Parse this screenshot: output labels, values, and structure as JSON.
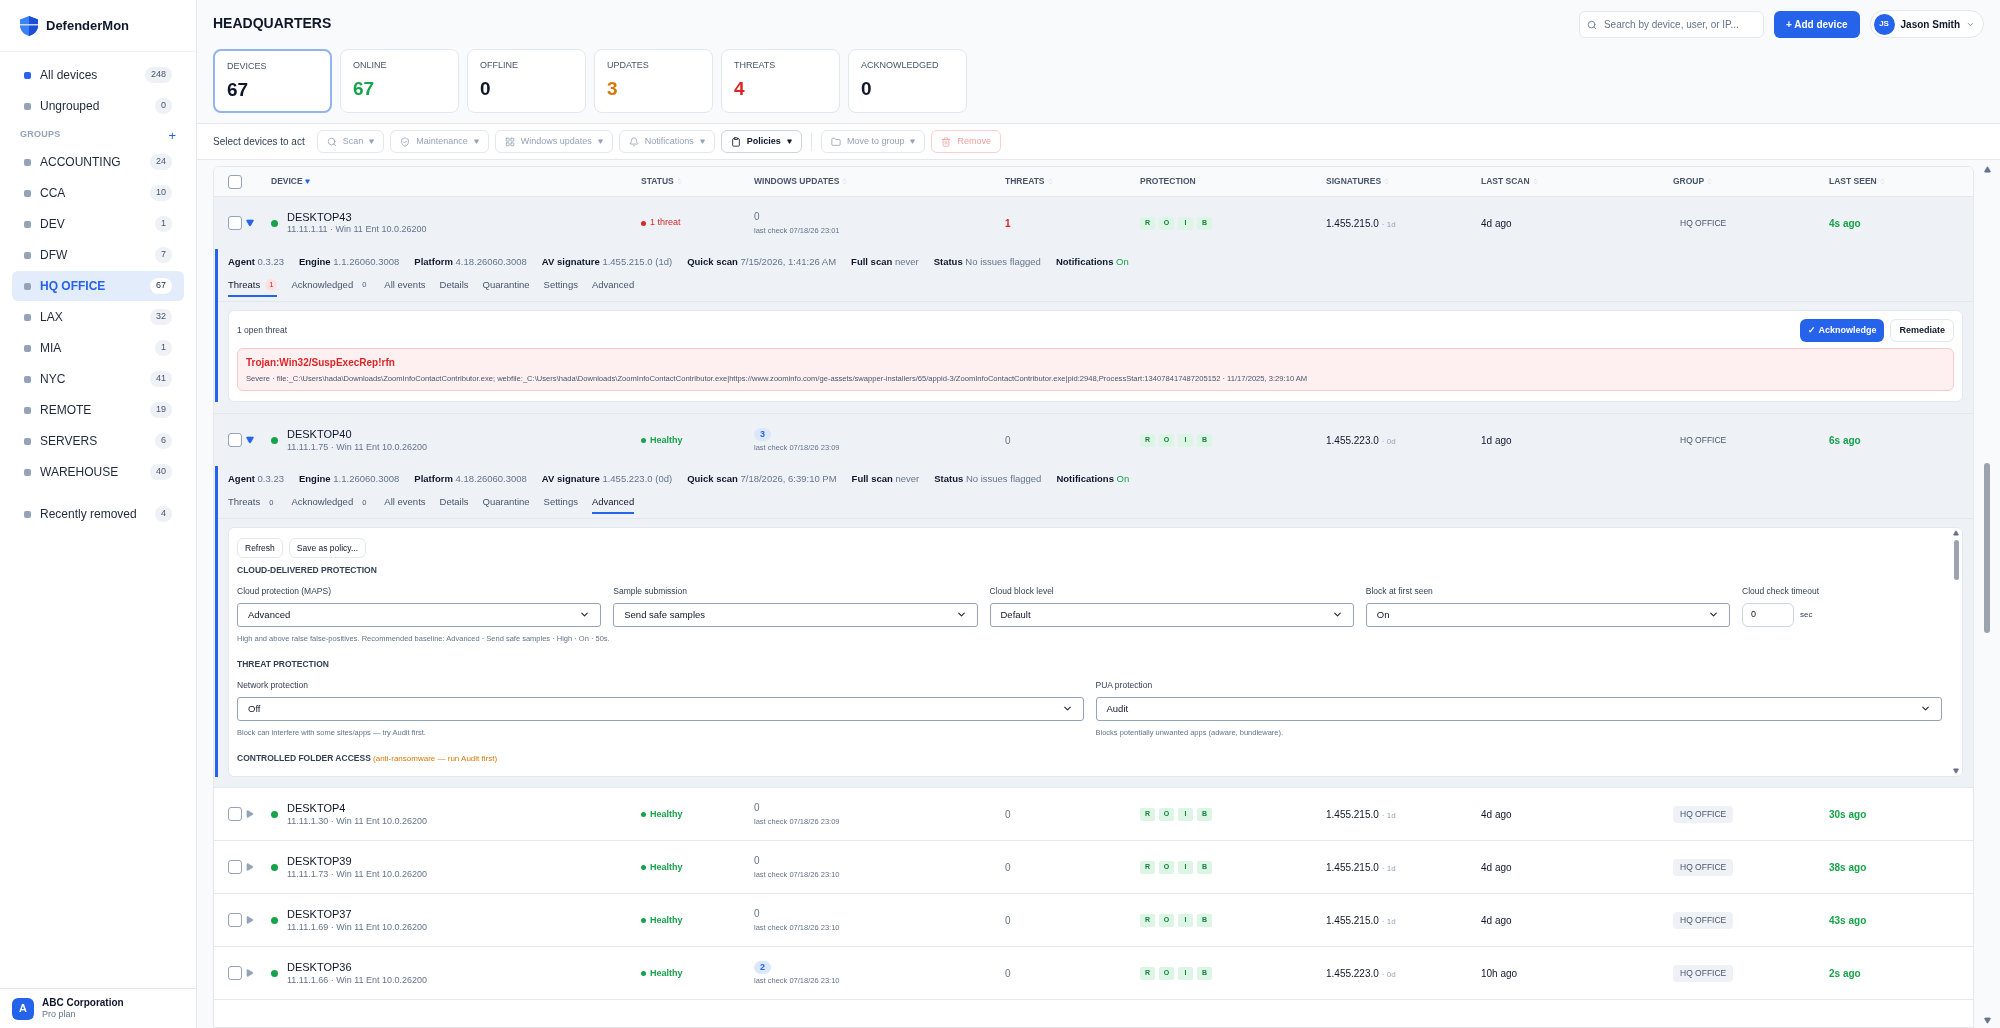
{
  "brand": {
    "name": "DefenderMon"
  },
  "sidebar": {
    "items": [
      {
        "label": "All devices",
        "count": "248",
        "selected": false,
        "color": "#2563eb"
      },
      {
        "label": "Ungrouped",
        "count": "0",
        "selected": false,
        "color": "#94a3b8"
      }
    ],
    "groups_heading": "GROUPS",
    "add_label": "+",
    "groups": [
      {
        "label": "ACCOUNTING",
        "count": "24",
        "selected": false
      },
      {
        "label": "CCA",
        "count": "10",
        "selected": false
      },
      {
        "label": "DEV",
        "count": "1",
        "selected": false
      },
      {
        "label": "DFW",
        "count": "7",
        "selected": false
      },
      {
        "label": "HQ OFFICE",
        "count": "67",
        "selected": true
      },
      {
        "label": "LAX",
        "count": "32",
        "selected": false
      },
      {
        "label": "MIA",
        "count": "1",
        "selected": false
      },
      {
        "label": "NYC",
        "count": "41",
        "selected": false
      },
      {
        "label": "REMOTE",
        "count": "19",
        "selected": false
      },
      {
        "label": "SERVERS",
        "count": "6",
        "selected": false
      },
      {
        "label": "WAREHOUSE",
        "count": "40",
        "selected": false
      }
    ],
    "removed": {
      "label": "Recently removed",
      "count": "4"
    },
    "org": {
      "initial": "A",
      "name": "ABC Corporation",
      "plan": "Pro plan"
    }
  },
  "header": {
    "title": "HEADQUARTERS",
    "search": {
      "placeholder": "Search by device, user, or IP..."
    },
    "add_button": "+ Add device",
    "user": {
      "initials": "JS",
      "name": "Jason Smith"
    }
  },
  "stats": [
    {
      "label": "DEVICES",
      "value": "67",
      "selected": true,
      "color": "#0f172a"
    },
    {
      "label": "ONLINE",
      "value": "67",
      "selected": false,
      "color": "#16a34a"
    },
    {
      "label": "OFFLINE",
      "value": "0",
      "selected": false,
      "color": "#0f172a"
    },
    {
      "label": "UPDATES",
      "value": "3",
      "selected": false,
      "color": "#d97706"
    },
    {
      "label": "THREATS",
      "value": "4",
      "selected": false,
      "color": "#dc2626"
    },
    {
      "label": "ACKNOWLEDGED",
      "value": "0",
      "selected": false,
      "color": "#0f172a"
    }
  ],
  "toolbar": {
    "hint": "Select devices to act",
    "actions": [
      {
        "label": "Scan",
        "disabled": true,
        "danger": false,
        "menu": true
      },
      {
        "label": "Maintenance",
        "disabled": true,
        "danger": false,
        "menu": true
      },
      {
        "label": "Windows updates",
        "disabled": true,
        "danger": false,
        "menu": true
      },
      {
        "label": "Notifications",
        "disabled": true,
        "danger": false,
        "menu": true
      },
      {
        "label": "Policies",
        "disabled": false,
        "danger": false,
        "menu": true
      },
      {
        "label": "Move to group",
        "disabled": true,
        "danger": false,
        "menu": true
      },
      {
        "label": "Remove",
        "disabled": true,
        "danger": true,
        "menu": false
      }
    ]
  },
  "table": {
    "select_all": {
      "checked": false
    },
    "columns": [
      {
        "label": "DEVICE",
        "sortable": true,
        "sorted": true
      },
      {
        "label": "STATUS",
        "sortable": true,
        "sorted": false
      },
      {
        "label": "WINDOWS UPDATES",
        "sortable": true,
        "sorted": false
      },
      {
        "label": "THREATS",
        "sortable": true,
        "sorted": false
      },
      {
        "label": "PROTECTION",
        "sortable": false
      },
      {
        "label": "SIGNATURES",
        "sortable": true,
        "sorted": false
      },
      {
        "label": "LAST SCAN",
        "sortable": true,
        "sorted": false
      },
      {
        "label": "GROUP",
        "sortable": true,
        "sorted": false
      },
      {
        "label": "LAST SEEN",
        "sortable": true,
        "sorted": false
      }
    ],
    "rows": [
      {
        "name": "DESKTOP43",
        "checked": false,
        "subtitle": "11.11.1.11 · Win 11 Ent 10.0.26200",
        "expanded": true,
        "status": {
          "kind": "threat",
          "text": "1 threat"
        },
        "updates": {
          "count": "0",
          "pending": false,
          "last_check": "last check 07/18/26 23:01"
        },
        "threats": "1",
        "protection": [
          "R",
          "O",
          "I",
          "B"
        ],
        "signature": "1.455.215.0",
        "signature_age": "· 1d",
        "last_scan": "4d ago",
        "group": "HQ OFFICE",
        "last_seen": "4s ago",
        "details": {
          "info": [
            {
              "label": "Agent",
              "value": "0.3.23",
              "good": false
            },
            {
              "label": "Engine",
              "value": "1.1.26060.3008",
              "good": false
            },
            {
              "label": "Platform",
              "value": "4.18.26060.3008",
              "good": false
            },
            {
              "label": "AV signature",
              "value": "1.455.215.0 (1d)",
              "good": false
            },
            {
              "label": "Quick scan",
              "value": "7/15/2026, 1:41:26 AM",
              "good": false
            },
            {
              "label": "Full scan",
              "value": "never",
              "good": false
            },
            {
              "label": "Status",
              "value": "No issues flagged",
              "good": false
            },
            {
              "label": "Notifications",
              "value": "On",
              "good": true
            }
          ],
          "tabs": [
            {
              "label": "Threats",
              "count": "1",
              "alert": true,
              "selected": true
            },
            {
              "label": "Acknowledged",
              "count": "0",
              "alert": false,
              "selected": false
            },
            {
              "label": "All events",
              "selected": false
            },
            {
              "label": "Details",
              "selected": false
            },
            {
              "label": "Quarantine",
              "selected": false
            },
            {
              "label": "Settings",
              "selected": false
            },
            {
              "label": "Advanced",
              "selected": false
            }
          ],
          "panel": {
            "kind": "threats",
            "summary": "1 open threat",
            "actions": [
              {
                "label": "✓ Acknowledge",
                "primary": true
              },
              {
                "label": "Remediate",
                "primary": false
              }
            ],
            "threats": [
              {
                "name": "Trojan:Win32/SuspExecRep!rfn",
                "detail": "Severe · file:_C:\\Users\\hada\\Downloads\\ZoomInfoContactContributor.exe; webfile:_C:\\Users\\hada\\Downloads\\ZoomInfoContactContributor.exe|https://www.zoominfo.com/ge-assets/swapper-installers/65/appid-3/ZoomInfoContactContributor.exe|pid:2948,ProcessStart:134078417487205152 · 11/17/2025, 3:29:10 AM"
              }
            ]
          }
        }
      },
      {
        "name": "DESKTOP40",
        "checked": false,
        "subtitle": "11.11.1.75 · Win 11 Ent 10.0.26200",
        "expanded": true,
        "status": {
          "kind": "healthy",
          "text": "Healthy"
        },
        "updates": {
          "count": "3",
          "pending": true,
          "last_check": "last check 07/18/26 23:09"
        },
        "threats": "0",
        "protection": [
          "R",
          "O",
          "I",
          "B"
        ],
        "signature": "1.455.223.0",
        "signature_age": "· 0d",
        "last_scan": "1d ago",
        "group": "HQ OFFICE",
        "last_seen": "6s ago",
        "details": {
          "info": [
            {
              "label": "Agent",
              "value": "0.3.23",
              "good": false
            },
            {
              "label": "Engine",
              "value": "1.1.26060.3008",
              "good": false
            },
            {
              "label": "Platform",
              "value": "4.18.26060.3008",
              "good": false
            },
            {
              "label": "AV signature",
              "value": "1.455.223.0 (0d)",
              "good": false
            },
            {
              "label": "Quick scan",
              "value": "7/18/2026, 6:39:10 PM",
              "good": false
            },
            {
              "label": "Full scan",
              "value": "never",
              "good": false
            },
            {
              "label": "Status",
              "value": "No issues flagged",
              "good": false
            },
            {
              "label": "Notifications",
              "value": "On",
              "good": true
            }
          ],
          "tabs": [
            {
              "label": "Threats",
              "count": "0",
              "alert": false,
              "selected": false
            },
            {
              "label": "Acknowledged",
              "count": "0",
              "alert": false,
              "selected": false
            },
            {
              "label": "All events",
              "selected": false
            },
            {
              "label": "Details",
              "selected": false
            },
            {
              "label": "Quarantine",
              "selected": false
            },
            {
              "label": "Settings",
              "selected": false
            },
            {
              "label": "Advanced",
              "selected": true
            }
          ],
          "panel": {
            "kind": "advanced",
            "buttons": [
              "Refresh",
              "Save as policy..."
            ],
            "sections": [
              {
                "title": "CLOUD-DELIVERED PROTECTION",
                "fields": [
                  {
                    "label": "Cloud protection (MAPS)",
                    "value": "Advanced",
                    "kind": "select"
                  },
                  {
                    "label": "Sample submission",
                    "value": "Send safe samples",
                    "kind": "select"
                  },
                  {
                    "label": "Cloud block level",
                    "value": "Default",
                    "kind": "select"
                  },
                  {
                    "label": "Block at first seen",
                    "value": "On",
                    "kind": "select"
                  },
                  {
                    "label": "Cloud check timeout",
                    "value": "0",
                    "kind": "number",
                    "unit": "sec"
                  }
                ],
                "hint": "High and above raise false-positives. Recommended baseline: Advanced · Send safe samples · High · On · 50s."
              },
              {
                "title": "THREAT PROTECTION",
                "fields": [
                  {
                    "label": "Network protection",
                    "value": "Off",
                    "kind": "select",
                    "hint": "Block can interfere with some sites/apps — try Audit first."
                  },
                  {
                    "label": "PUA protection",
                    "value": "Audit",
                    "kind": "select",
                    "hint": "Blocks potentially unwanted apps (adware, bundleware)."
                  }
                ]
              },
              {
                "title": "CONTROLLED FOLDER ACCESS",
                "note": "(anti-ransomware — run Audit first)"
              }
            ]
          }
        }
      },
      {
        "name": "DESKTOP4",
        "checked": false,
        "subtitle": "11.11.1.30 · Win 11 Ent 10.0.26200",
        "expanded": false,
        "status": {
          "kind": "healthy",
          "text": "Healthy"
        },
        "updates": {
          "count": "0",
          "pending": false,
          "last_check": "last check 07/18/26 23:09"
        },
        "threats": "0",
        "protection": [
          "R",
          "O",
          "I",
          "B"
        ],
        "signature": "1.455.215.0",
        "signature_age": "· 1d",
        "last_scan": "4d ago",
        "group": "HQ OFFICE",
        "last_seen": "30s ago"
      },
      {
        "name": "DESKTOP39",
        "checked": false,
        "subtitle": "11.11.1.73 · Win 11 Ent 10.0.26200",
        "expanded": false,
        "status": {
          "kind": "healthy",
          "text": "Healthy"
        },
        "updates": {
          "count": "0",
          "pending": false,
          "last_check": "last check 07/18/26 23:10"
        },
        "threats": "0",
        "protection": [
          "R",
          "O",
          "I",
          "B"
        ],
        "signature": "1.455.215.0",
        "signature_age": "· 1d",
        "last_scan": "4d ago",
        "group": "HQ OFFICE",
        "last_seen": "38s ago"
      },
      {
        "name": "DESKTOP37",
        "checked": false,
        "subtitle": "11.11.1.69 · Win 11 Ent 10.0.26200",
        "expanded": false,
        "status": {
          "kind": "healthy",
          "text": "Healthy"
        },
        "updates": {
          "count": "0",
          "pending": false,
          "last_check": "last check 07/18/26 23:10"
        },
        "threats": "0",
        "protection": [
          "R",
          "O",
          "I",
          "B"
        ],
        "signature": "1.455.215.0",
        "signature_age": "· 1d",
        "last_scan": "4d ago",
        "group": "HQ OFFICE",
        "last_seen": "43s ago"
      },
      {
        "name": "DESKTOP36",
        "checked": false,
        "subtitle": "11.11.1.66 · Win 11 Ent 10.0.26200",
        "expanded": false,
        "status": {
          "kind": "healthy",
          "text": "Healthy"
        },
        "updates": {
          "count": "2",
          "pending": true,
          "last_check": "last check 07/18/26 23:10"
        },
        "threats": "0",
        "protection": [
          "R",
          "O",
          "I",
          "B"
        ],
        "signature": "1.455.223.0",
        "signature_age": "· 0d",
        "last_scan": "10h ago",
        "group": "HQ OFFICE",
        "last_seen": "2s ago"
      }
    ]
  }
}
